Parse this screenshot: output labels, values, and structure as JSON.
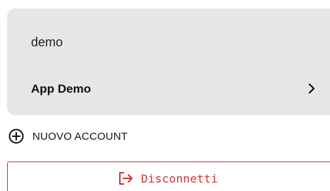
{
  "account": {
    "name": "demo",
    "app": {
      "label": "App Demo",
      "icon": "chevron-right-icon"
    }
  },
  "new_account": {
    "label": "NUOVO ACCOUNT",
    "icon": "plus-circle-icon"
  },
  "logout": {
    "label": "Disconnetti",
    "icon": "logout-icon",
    "color": "#d32f2f"
  },
  "colors": {
    "card_background": "#e6e6e6",
    "accent_red": "#d32f2f"
  }
}
